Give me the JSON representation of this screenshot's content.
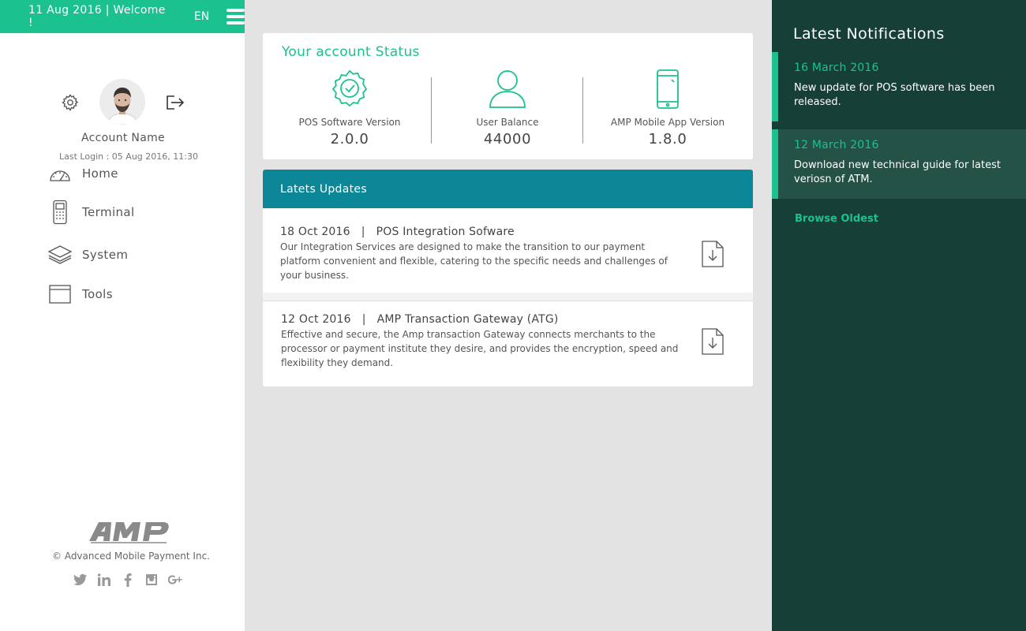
{
  "header": {
    "greeting": "11 Aug 2016 | Welcome !",
    "language": "EN",
    "menu_icon": "hamburger-icon"
  },
  "profile": {
    "account_name": "Account Name",
    "last_login": "Last Login : 05 Aug 2016, 11:30",
    "settings_icon": "gear-icon",
    "logout_icon": "logout-icon"
  },
  "nav": {
    "items": [
      {
        "label": "Home",
        "icon": "speedometer-icon"
      },
      {
        "label": "Terminal",
        "icon": "pos-terminal-icon"
      },
      {
        "label": "System",
        "icon": "layers-icon"
      },
      {
        "label": "Tools",
        "icon": "window-icon"
      }
    ]
  },
  "footer": {
    "logo_text": "AMP",
    "copyright": "© Advanced Mobile Payment Inc.",
    "social": [
      "twitter-icon",
      "linkedin-icon",
      "facebook-icon",
      "instagram-icon",
      "google-plus-icon"
    ]
  },
  "account_status": {
    "title": "Your account Status",
    "stats": [
      {
        "label": "POS Software Version",
        "value": "2.0.0",
        "icon": "badge-check-icon"
      },
      {
        "label": "User Balance",
        "value": "44000",
        "icon": "user-icon"
      },
      {
        "label": "AMP Mobile App Version",
        "value": "1.8.0",
        "icon": "smartphone-icon"
      }
    ]
  },
  "updates": {
    "title": "Latets Updates",
    "items": [
      {
        "date": "18 Oct 2016",
        "title": "POS Integration Sofware",
        "description": "Our Integration Services are designed to make the transition to our payment platform convenient and flexible, catering to the specific needs and challenges of your business."
      },
      {
        "date": "12 Oct 2016",
        "title": "AMP Transaction Gateway (ATG)",
        "description": "Effective and secure, the Amp transaction Gateway connects merchants to the processor or payment institute they desire, and provides the encryption, speed and flexibility they demand."
      }
    ]
  },
  "notifications": {
    "title": "Latest Notifications",
    "items": [
      {
        "date": "16  March 2016",
        "text": "New update for POS software has been released."
      },
      {
        "date": "12  March 2016",
        "text": "Download new technical guide for latest veriosn of ATM."
      }
    ],
    "browse_label": "Browse Oldest"
  },
  "colors": {
    "accent": "#1cc190",
    "updates_header": "#0c8798",
    "notifications_bg": "#163f37",
    "notification_active_bg": "#245247"
  }
}
